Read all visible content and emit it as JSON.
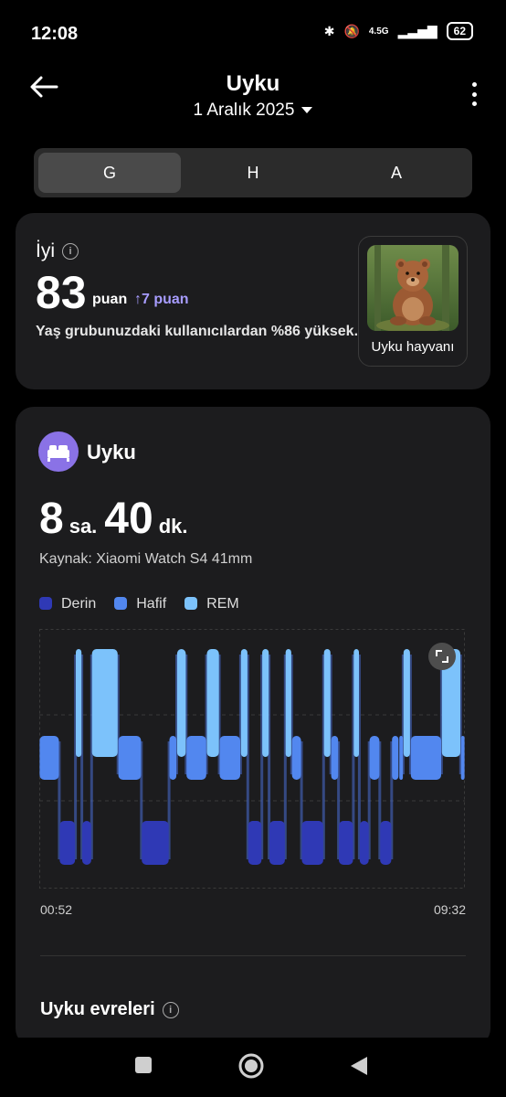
{
  "status_bar": {
    "time": "12:08",
    "network": "4.5G",
    "battery": "62"
  },
  "header": {
    "title": "Uyku",
    "date": "1 Aralık 2025"
  },
  "tabs": [
    {
      "label": "G",
      "active": true
    },
    {
      "label": "H",
      "active": false
    },
    {
      "label": "A",
      "active": false
    }
  ],
  "score_card": {
    "quality": "İyi",
    "score": "83",
    "unit": "puan",
    "delta": "7 puan",
    "comparison": "Yaş grubunuzdaki kullanıcılardan %86 yüksek.",
    "animal_label": "Uyku hayvanı"
  },
  "sleep_card": {
    "title": "Uyku",
    "hours": "8",
    "hours_unit": "sa.",
    "minutes": "40",
    "minutes_unit": "dk.",
    "source": "Kaynak: Xiaomi Watch S4 41mm",
    "legend": [
      {
        "label": "Derin",
        "color": "#2f39b5"
      },
      {
        "label": "Hafif",
        "color": "#5287ef"
      },
      {
        "label": "REM",
        "color": "#7cc2fb"
      }
    ],
    "start_time": "00:52",
    "end_time": "09:32",
    "stages_title": "Uyku evreleri"
  },
  "chart_data": {
    "type": "hypnogram",
    "levels": [
      "REM",
      "Hafif",
      "Derin"
    ],
    "x_range": [
      "00:52",
      "09:32"
    ],
    "segments": [
      {
        "stage": "Hafif",
        "start": 0.0,
        "end": 0.047
      },
      {
        "stage": "Derin",
        "start": 0.047,
        "end": 0.085
      },
      {
        "stage": "REM",
        "start": 0.085,
        "end": 0.1
      },
      {
        "stage": "Derin",
        "start": 0.1,
        "end": 0.123
      },
      {
        "stage": "REM",
        "start": 0.123,
        "end": 0.185
      },
      {
        "stage": "Hafif",
        "start": 0.185,
        "end": 0.24
      },
      {
        "stage": "Derin",
        "start": 0.24,
        "end": 0.305
      },
      {
        "stage": "Hafif",
        "start": 0.305,
        "end": 0.323
      },
      {
        "stage": "REM",
        "start": 0.323,
        "end": 0.345
      },
      {
        "stage": "Hafif",
        "start": 0.345,
        "end": 0.393
      },
      {
        "stage": "REM",
        "start": 0.393,
        "end": 0.423
      },
      {
        "stage": "Hafif",
        "start": 0.423,
        "end": 0.473
      },
      {
        "stage": "REM",
        "start": 0.473,
        "end": 0.49
      },
      {
        "stage": "Derin",
        "start": 0.49,
        "end": 0.523
      },
      {
        "stage": "REM",
        "start": 0.523,
        "end": 0.54
      },
      {
        "stage": "Derin",
        "start": 0.54,
        "end": 0.578
      },
      {
        "stage": "REM",
        "start": 0.578,
        "end": 0.593
      },
      {
        "stage": "Hafif",
        "start": 0.593,
        "end": 0.616
      },
      {
        "stage": "Derin",
        "start": 0.616,
        "end": 0.668
      },
      {
        "stage": "REM",
        "start": 0.668,
        "end": 0.685
      },
      {
        "stage": "Hafif",
        "start": 0.685,
        "end": 0.703
      },
      {
        "stage": "Derin",
        "start": 0.703,
        "end": 0.738
      },
      {
        "stage": "REM",
        "start": 0.738,
        "end": 0.752
      },
      {
        "stage": "Derin",
        "start": 0.752,
        "end": 0.775
      },
      {
        "stage": "Hafif",
        "start": 0.775,
        "end": 0.8
      },
      {
        "stage": "Derin",
        "start": 0.8,
        "end": 0.828
      },
      {
        "stage": "Hafif",
        "start": 0.828,
        "end": 0.845
      },
      {
        "stage": "Hafif",
        "start": 0.845,
        "end": 0.845
      },
      {
        "stage": "Hafif",
        "start": 0.845,
        "end": 0.855
      },
      {
        "stage": "Hafif",
        "start": 0.855,
        "end": 0.855
      },
      {
        "stage": "Hafif",
        "start": 0.855,
        "end": 0.855
      },
      {
        "stage": "Hafif",
        "start": 0.855,
        "end": 0.855
      },
      {
        "stage": "Hafif",
        "start": 0.855,
        "end": 0.855
      },
      {
        "stage": "Hafif",
        "start": 0.855,
        "end": 0.855
      },
      {
        "stage": "Hafif",
        "start": 0.855,
        "end": 0.855
      },
      {
        "stage": "Hafif",
        "start": 0.855,
        "end": 0.855
      },
      {
        "stage": "Hafif",
        "start": 0.855,
        "end": 0.855
      },
      {
        "stage": "Hafif",
        "start": 0.855,
        "end": 0.855
      },
      {
        "stage": "Hafif",
        "start": 0.855,
        "end": 0.855
      },
      {
        "stage": "Hafif",
        "start": 0.855,
        "end": 0.855
      },
      {
        "stage": "Hafif",
        "start": 0.855,
        "end": 0.855
      },
      {
        "stage": "REM",
        "start": 0.855,
        "end": 0.872
      },
      {
        "stage": "Hafif",
        "start": 0.872,
        "end": 0.945
      },
      {
        "stage": "REM",
        "start": 0.945,
        "end": 0.99
      },
      {
        "stage": "Hafif",
        "start": 0.99,
        "end": 1.0
      }
    ]
  }
}
